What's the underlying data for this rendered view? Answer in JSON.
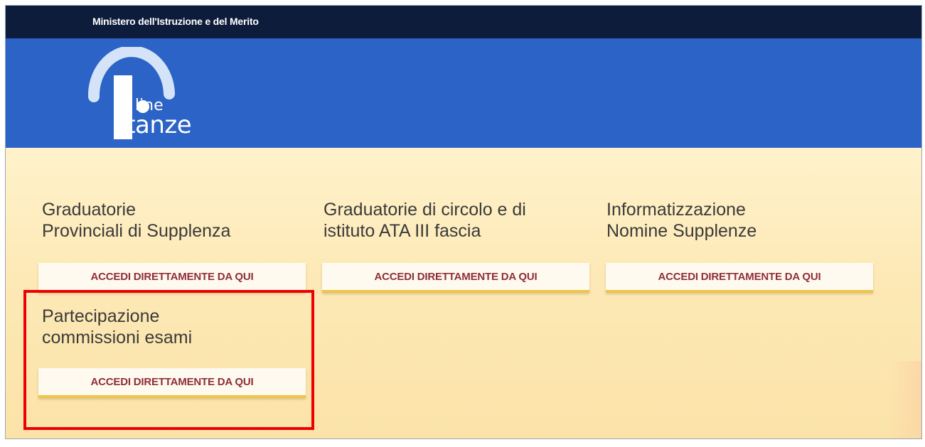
{
  "header": {
    "ministry": "Ministero dell'Istruzione e del Merito",
    "logo": {
      "line1": "On line",
      "line1_display": "n line",
      "line2": "stanze",
      "colors": {
        "arc": "#cfe0f7",
        "text": "#ffffff"
      }
    }
  },
  "cards": [
    {
      "title": "Graduatorie\nProvinciali di Supplenza",
      "button": "ACCEDI DIRETTAMENTE DA QUI"
    },
    {
      "title": "Graduatorie di circolo e di\nistituto ATA III fascia",
      "button": "ACCEDI DIRETTAMENTE DA QUI"
    },
    {
      "title": "Informatizzazione\nNomine Supplenze",
      "button": "ACCEDI DIRETTAMENTE DA QUI"
    },
    {
      "title": "Partecipazione\ncommissioni esami",
      "button": "ACCEDI DIRETTAMENTE DA QUI"
    }
  ],
  "colors": {
    "topbar": "#0e1c3b",
    "header": "#2b63c6",
    "content_bg": "#fde9b6",
    "button_text": "#8f2f37",
    "button_underline": "#efc54b",
    "highlight": "#ee0000"
  }
}
